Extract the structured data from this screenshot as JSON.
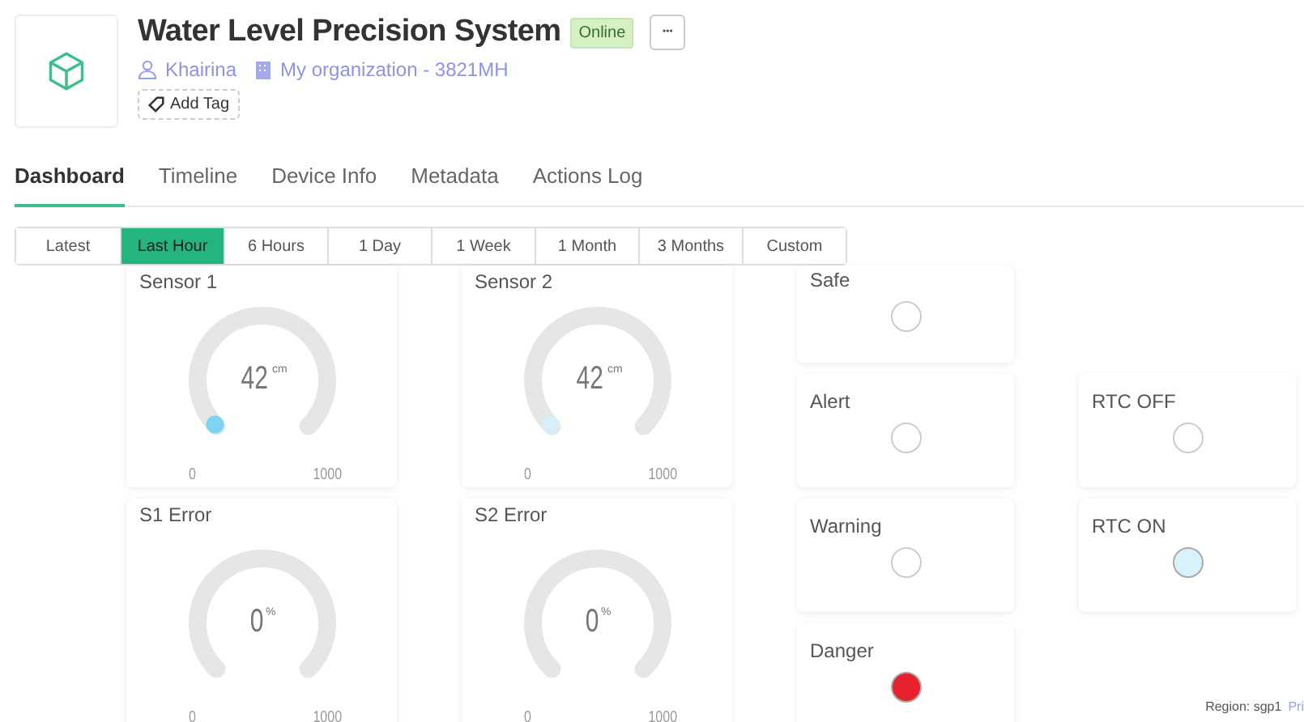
{
  "device": {
    "title": "Water Level Precision System",
    "status": "Online",
    "owner": "Khairina",
    "organization": "My organization - 3821MH",
    "add_tag": "Add Tag",
    "more": "•••"
  },
  "tabs": [
    {
      "label": "Dashboard",
      "selected": true
    },
    {
      "label": "Timeline",
      "selected": false
    },
    {
      "label": "Device Info",
      "selected": false
    },
    {
      "label": "Metadata",
      "selected": false
    },
    {
      "label": "Actions Log",
      "selected": false
    }
  ],
  "ranges": [
    {
      "label": "Latest",
      "selected": false
    },
    {
      "label": "Last Hour",
      "selected": true
    },
    {
      "label": "6 Hours",
      "selected": false
    },
    {
      "label": "1 Day",
      "selected": false
    },
    {
      "label": "1 Week",
      "selected": false
    },
    {
      "label": "1 Month",
      "selected": false
    },
    {
      "label": "3 Months",
      "selected": false
    },
    {
      "label": "Custom",
      "selected": false
    }
  ],
  "gauges": [
    {
      "title": "Sensor 1",
      "value": "42",
      "unit": "cm",
      "min": "0",
      "max": "1000",
      "color": "#7fd3f2"
    },
    {
      "title": "Sensor 2",
      "value": "42",
      "unit": "cm",
      "min": "0",
      "max": "1000",
      "color": "#d6eff9"
    },
    {
      "title": "S1 Error",
      "value": "0",
      "unit": "%",
      "min": "0",
      "max": "1000"
    },
    {
      "title": "S2 Error",
      "value": "0",
      "unit": "%",
      "min": "0",
      "max": "1000"
    }
  ],
  "leds": [
    {
      "title": "Safe",
      "on": false
    },
    {
      "title": "Alert",
      "on": false
    },
    {
      "title": "Warning",
      "on": false
    },
    {
      "title": "Danger",
      "on": true,
      "color": "#e8212e"
    },
    {
      "title": "RTC OFF",
      "on": false
    },
    {
      "title": "RTC ON",
      "on": true,
      "color": "#d8f1fb"
    }
  ],
  "footer": {
    "region": "Region: sgp1",
    "link": "Pri"
  }
}
